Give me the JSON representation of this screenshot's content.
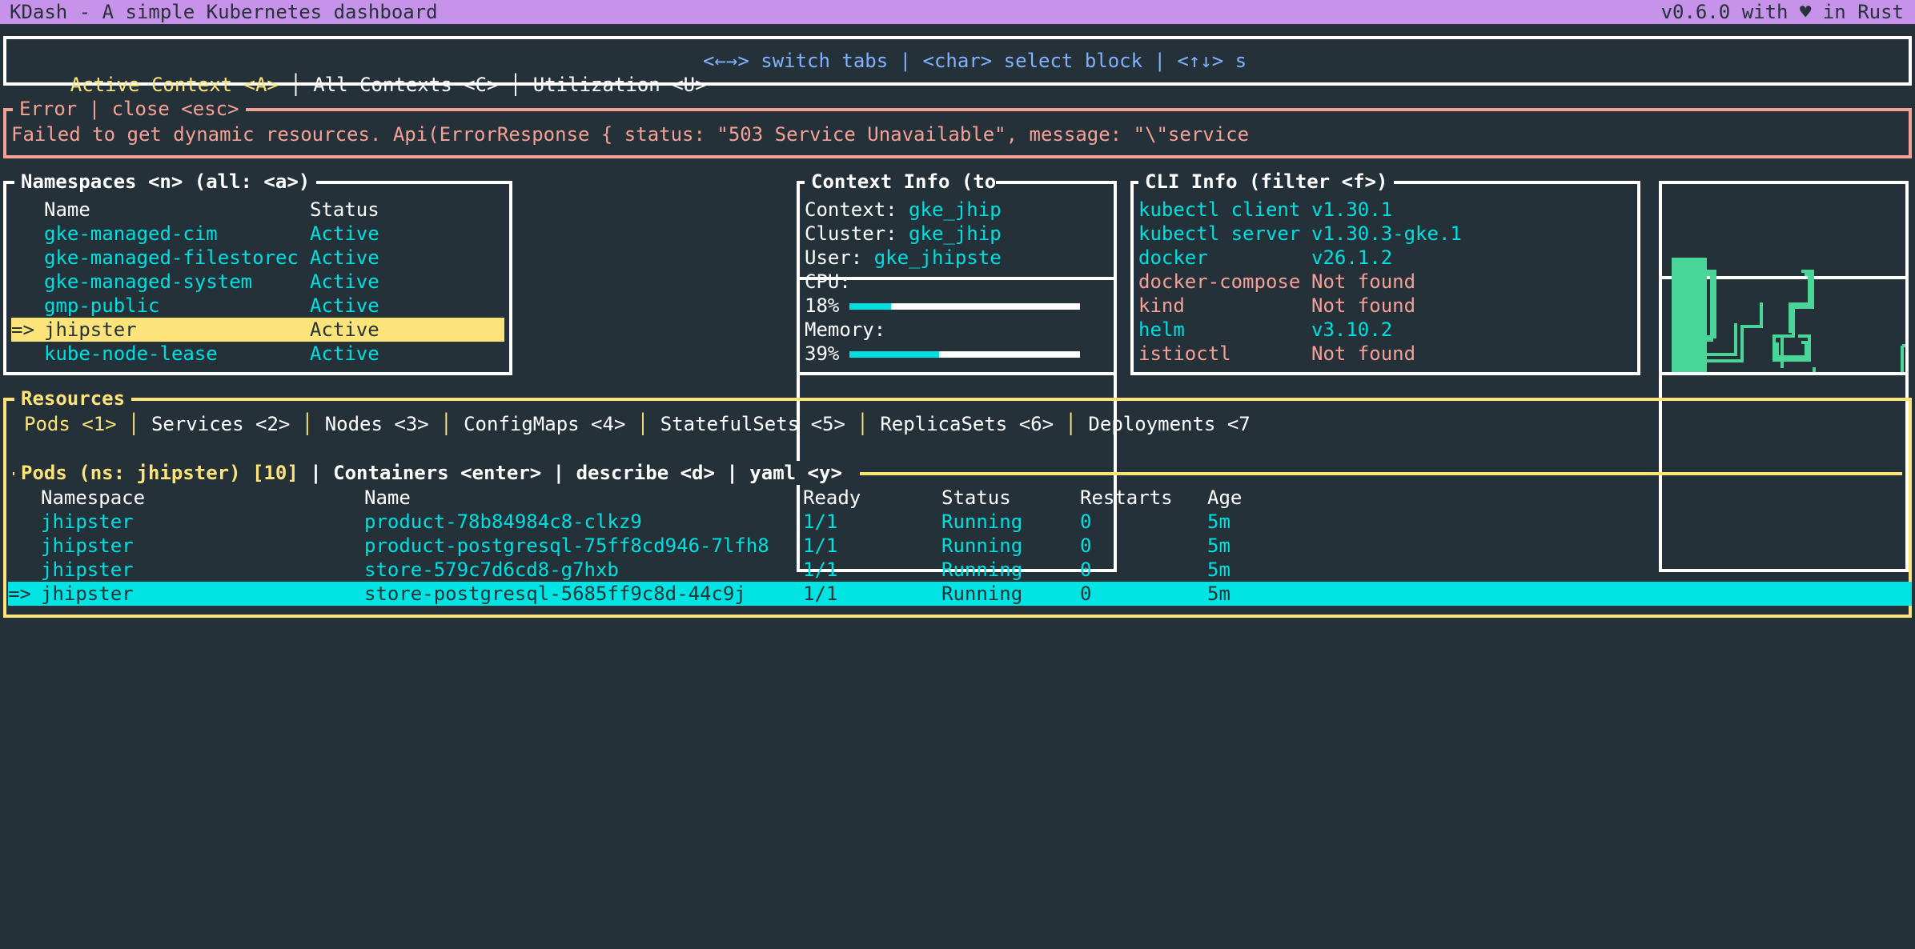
{
  "titlebar": {
    "title": "KDash - A simple Kubernetes dashboard",
    "version": "v0.6.0 with ♥ in Rust"
  },
  "top_tabs": {
    "items": [
      {
        "label": "Active Context <A>",
        "active": true
      },
      {
        "label": "All Contexts <C>",
        "active": false
      },
      {
        "label": "Utilization <U>",
        "active": false
      }
    ],
    "separator": "│",
    "help": "<←→> switch tabs | <char> select block | <↑↓> s"
  },
  "error": {
    "title": "Error | close <esc>",
    "message": "Failed to get dynamic resources. Api(ErrorResponse { status: \"503 Service Unavailable\", message: \"\\\"service"
  },
  "namespaces": {
    "title": "Namespaces <n> (all: <a>)",
    "headers": [
      "Name",
      "Status"
    ],
    "selected_marker": "=>",
    "rows": [
      {
        "name": "gke-managed-cim",
        "status": "Active"
      },
      {
        "name": "gke-managed-filestorec",
        "status": "Active"
      },
      {
        "name": "gke-managed-system",
        "status": "Active"
      },
      {
        "name": "gmp-public",
        "status": "Active"
      },
      {
        "name": "jhipster",
        "status": "Active",
        "selected": true
      },
      {
        "name": "kube-node-lease",
        "status": "Active"
      }
    ]
  },
  "context_info": {
    "title": "Context Info (to",
    "context_label": "Context: ",
    "context_value": "gke_jhip",
    "cluster_label": "Cluster: ",
    "cluster_value": "gke_jhip",
    "user_label": "User: ",
    "user_value": "gke_jhipste",
    "cpu_label": "CPU:",
    "cpu_text": "18%",
    "cpu_percent": 18,
    "memory_label": "Memory:",
    "memory_text": "39%",
    "memory_percent": 39
  },
  "cli_info": {
    "title": "CLI Info (filter <f>)",
    "rows": [
      {
        "name": "kubectl client",
        "version": "v1.30.1",
        "found": true
      },
      {
        "name": "kubectl server",
        "version": "v1.30.3-gke.1",
        "found": true
      },
      {
        "name": "docker",
        "version": "v26.1.2",
        "found": true
      },
      {
        "name": "docker-compose",
        "version": "Not found",
        "found": false
      },
      {
        "name": "kind",
        "version": "Not found",
        "found": false
      },
      {
        "name": "helm",
        "version": "v3.10.2",
        "found": true
      },
      {
        "name": "istioctl",
        "version": "Not found",
        "found": false
      }
    ]
  },
  "logo": {
    "icon": "kdash-logo-icon",
    "color": "#48d597"
  },
  "resources": {
    "title": "Resources",
    "tabs": [
      {
        "label": "Pods <1>",
        "active": true
      },
      {
        "label": "Services <2>",
        "active": false
      },
      {
        "label": "Nodes <3>",
        "active": false
      },
      {
        "label": "ConfigMaps <4>",
        "active": false
      },
      {
        "label": "StatefulSets <5>",
        "active": false
      },
      {
        "label": "ReplicaSets <6>",
        "active": false
      },
      {
        "label": "Deployments <7",
        "active": false
      }
    ],
    "separator": "│",
    "pods_title_main": "Pods (ns: jhipster) [10]",
    "pods_title_actions": " | Containers <enter> | describe <d> | yaml <y> ",
    "headers": [
      "Namespace",
      "Name",
      "Ready",
      "Status",
      "Restarts",
      "Age"
    ],
    "selected_marker": "=>",
    "rows": [
      {
        "namespace": "jhipster",
        "name": "product-78b84984c8-clkz9",
        "ready": "1/1",
        "status": "Running",
        "restarts": "0",
        "age": "5m"
      },
      {
        "namespace": "jhipster",
        "name": "product-postgresql-75ff8cd946-7lfh8",
        "ready": "1/1",
        "status": "Running",
        "restarts": "0",
        "age": "5m"
      },
      {
        "namespace": "jhipster",
        "name": "store-579c7d6cd8-g7hxb",
        "ready": "1/1",
        "status": "Running",
        "restarts": "0",
        "age": "5m"
      },
      {
        "namespace": "jhipster",
        "name": "store-postgresql-5685ff9c8d-44c9j",
        "ready": "1/1",
        "status": "Running",
        "restarts": "0",
        "age": "5m",
        "selected": true
      }
    ]
  },
  "colors": {
    "background": "#253139",
    "titlebar": "#c792ea",
    "accent_yellow": "#fde47a",
    "accent_cyan": "#00e0e0",
    "help_blue": "#82b1ff",
    "error_salmon": "#f5a097",
    "logo_green": "#48d597"
  }
}
